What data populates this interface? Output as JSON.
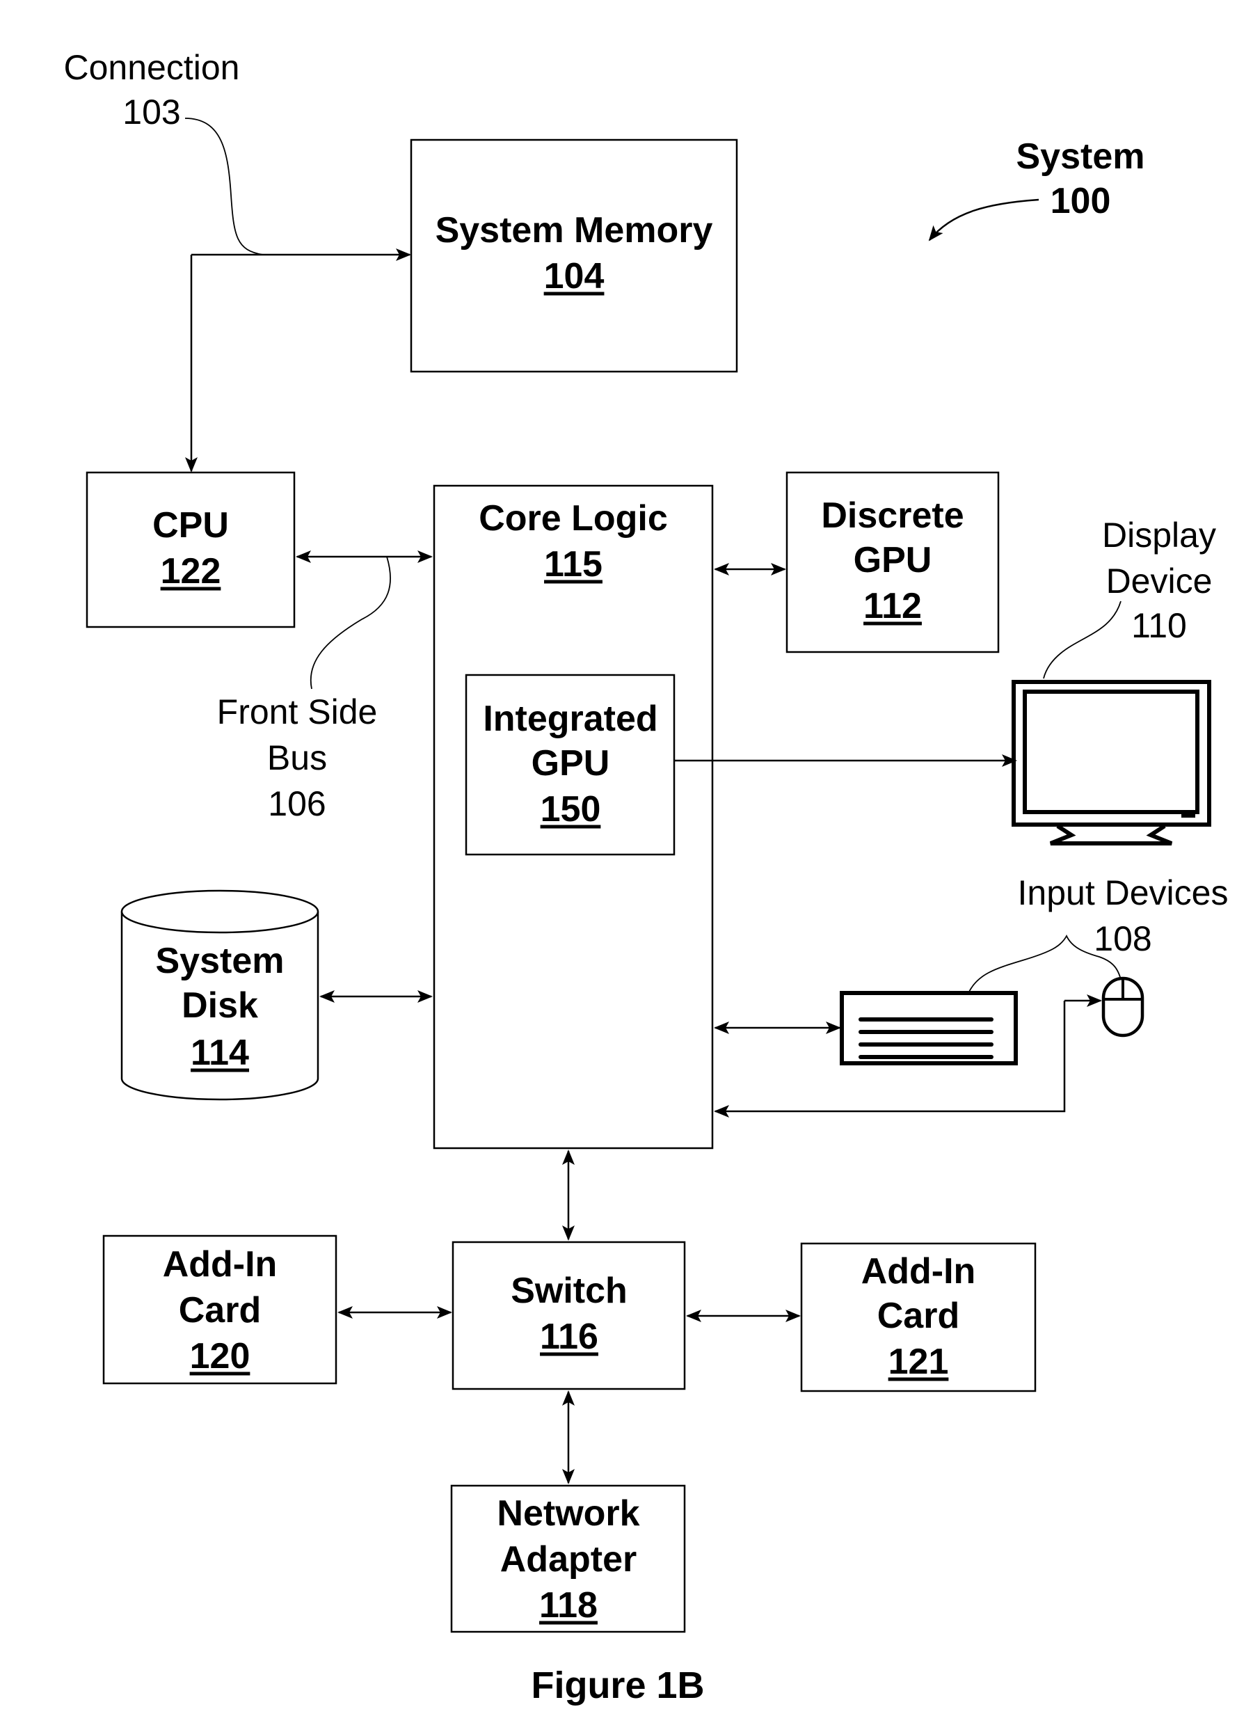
{
  "figure": {
    "title": "Figure 1B",
    "system": {
      "label": "System",
      "number": "100"
    }
  },
  "components": {
    "system_memory": {
      "label": "System Memory",
      "number": "104"
    },
    "cpu": {
      "label": "CPU",
      "number": "122"
    },
    "core_logic": {
      "label": "Core Logic",
      "number": "115"
    },
    "discrete_gpu": {
      "label_line1": "Discrete",
      "label_line2": "GPU",
      "number": "112"
    },
    "integrated_gpu": {
      "label_line1": "Integrated",
      "label_line2": "GPU",
      "number": "150"
    },
    "system_disk": {
      "label_line1": "System",
      "label_line2": "Disk",
      "number": "114"
    },
    "switch": {
      "label": "Switch",
      "number": "116"
    },
    "add_in_card_120": {
      "label_line1": "Add-In",
      "label_line2": "Card",
      "number": "120"
    },
    "add_in_card_121": {
      "label_line1": "Add-In",
      "label_line2": "Card",
      "number": "121"
    },
    "network_adapter": {
      "label_line1": "Network",
      "label_line2": "Adapter",
      "number": "118"
    }
  },
  "callouts": {
    "connection": {
      "label": "Connection",
      "number": "103"
    },
    "front_side_bus": {
      "label_line1": "Front Side",
      "label_line2": "Bus",
      "number": "106"
    },
    "display_device": {
      "label_line1": "Display",
      "label_line2": "Device",
      "number": "110"
    },
    "input_devices": {
      "label": "Input Devices",
      "number": "108"
    }
  }
}
